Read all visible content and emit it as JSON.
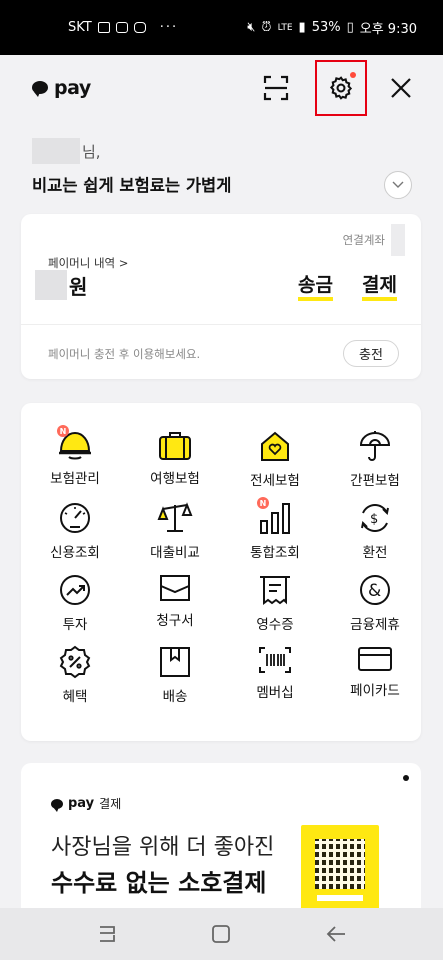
{
  "status_bar": {
    "carrier": "SKT",
    "dots": "···",
    "lte": "LTE",
    "battery": "53%",
    "time": "오후 9:30"
  },
  "header": {
    "logo_text": "pay",
    "icons": [
      "scan-icon",
      "gear-icon",
      "close-icon"
    ],
    "settings_has_notification": true
  },
  "greeting": {
    "suffix": "님,",
    "title": "비교는 쉽게 보험료는 가볍게"
  },
  "money": {
    "account_label": "연결계좌",
    "history_label": "페이머니 내역 >",
    "currency_unit": "원",
    "send_label": "송금",
    "pay_label": "결제",
    "charge_hint": "페이머니 충전 후 이용해보세요.",
    "charge_label": "충전"
  },
  "menu": [
    {
      "label": "보험관리",
      "icon": "helmet-icon",
      "badge": "N"
    },
    {
      "label": "여행보험",
      "icon": "suitcase-icon",
      "badge": ""
    },
    {
      "label": "전세보험",
      "icon": "house-heart-icon",
      "badge": ""
    },
    {
      "label": "간편보험",
      "icon": "umbrella-icon",
      "badge": ""
    },
    {
      "label": "신용조회",
      "icon": "gauge-icon",
      "badge": ""
    },
    {
      "label": "대출비교",
      "icon": "scale-icon",
      "badge": ""
    },
    {
      "label": "통합조회",
      "icon": "bar-chart-icon",
      "badge": "N"
    },
    {
      "label": "환전",
      "icon": "currency-exchange-icon",
      "badge": ""
    },
    {
      "label": "투자",
      "icon": "trend-up-icon",
      "badge": ""
    },
    {
      "label": "청구서",
      "icon": "envelope-icon",
      "badge": ""
    },
    {
      "label": "영수증",
      "icon": "receipt-icon",
      "badge": ""
    },
    {
      "label": "금융제휴",
      "icon": "ampersand-icon",
      "badge": ""
    },
    {
      "label": "혜택",
      "icon": "discount-badge-icon",
      "badge": ""
    },
    {
      "label": "배송",
      "icon": "box-icon",
      "badge": ""
    },
    {
      "label": "멤버십",
      "icon": "barcode-icon",
      "badge": ""
    },
    {
      "label": "페이카드",
      "icon": "card-icon",
      "badge": ""
    }
  ],
  "promo": {
    "brand": "pay",
    "brand_sub": "결제",
    "line1": "사장님을 위해 더 좋아진",
    "line2": "수수료 없는 소호결제"
  },
  "colors": {
    "accent_yellow": "#FFE812",
    "highlight_red": "#E60012",
    "badge_red": "#FF6A5A"
  }
}
